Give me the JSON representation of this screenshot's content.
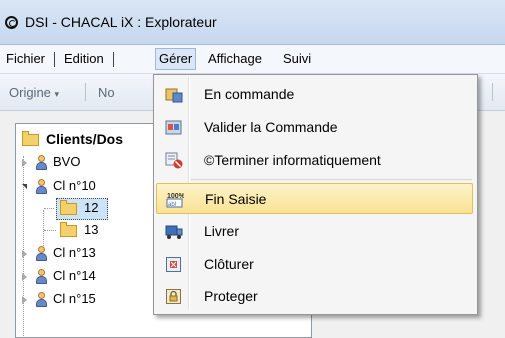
{
  "window": {
    "title": "DSI - CHACAL iX : Explorateur"
  },
  "menubar": {
    "items": [
      {
        "label": "Fichier"
      },
      {
        "label": "Edition"
      },
      {
        "label": "Gérer"
      },
      {
        "label": "Affichage"
      },
      {
        "label": "Suivi"
      }
    ]
  },
  "toolbar": {
    "origine_label": "Origine",
    "partial_label": "No"
  },
  "tree": {
    "root": "Clients/Dos",
    "nodes": [
      {
        "label": "BVO"
      },
      {
        "label": "Cl n°10"
      },
      {
        "label": "12"
      },
      {
        "label": "13"
      },
      {
        "label": "Cl n°13"
      },
      {
        "label": "Cl n°14"
      },
      {
        "label": "Cl n°15"
      }
    ]
  },
  "dropdown": {
    "items": [
      {
        "label": "En commande",
        "icon": "order-icon"
      },
      {
        "label": "Valider la Commande",
        "icon": "validate-order-icon"
      },
      {
        "label": "©Terminer informatiquement",
        "icon": "terminate-icon"
      },
      {
        "label": "Fin Saisie",
        "icon": "end-input-icon"
      },
      {
        "label": "Livrer",
        "icon": "delivery-truck-icon"
      },
      {
        "label": "Clôturer",
        "icon": "close-box-icon"
      },
      {
        "label": "Proteger",
        "icon": "lock-icon"
      }
    ],
    "highlighted": "Fin Saisie"
  }
}
